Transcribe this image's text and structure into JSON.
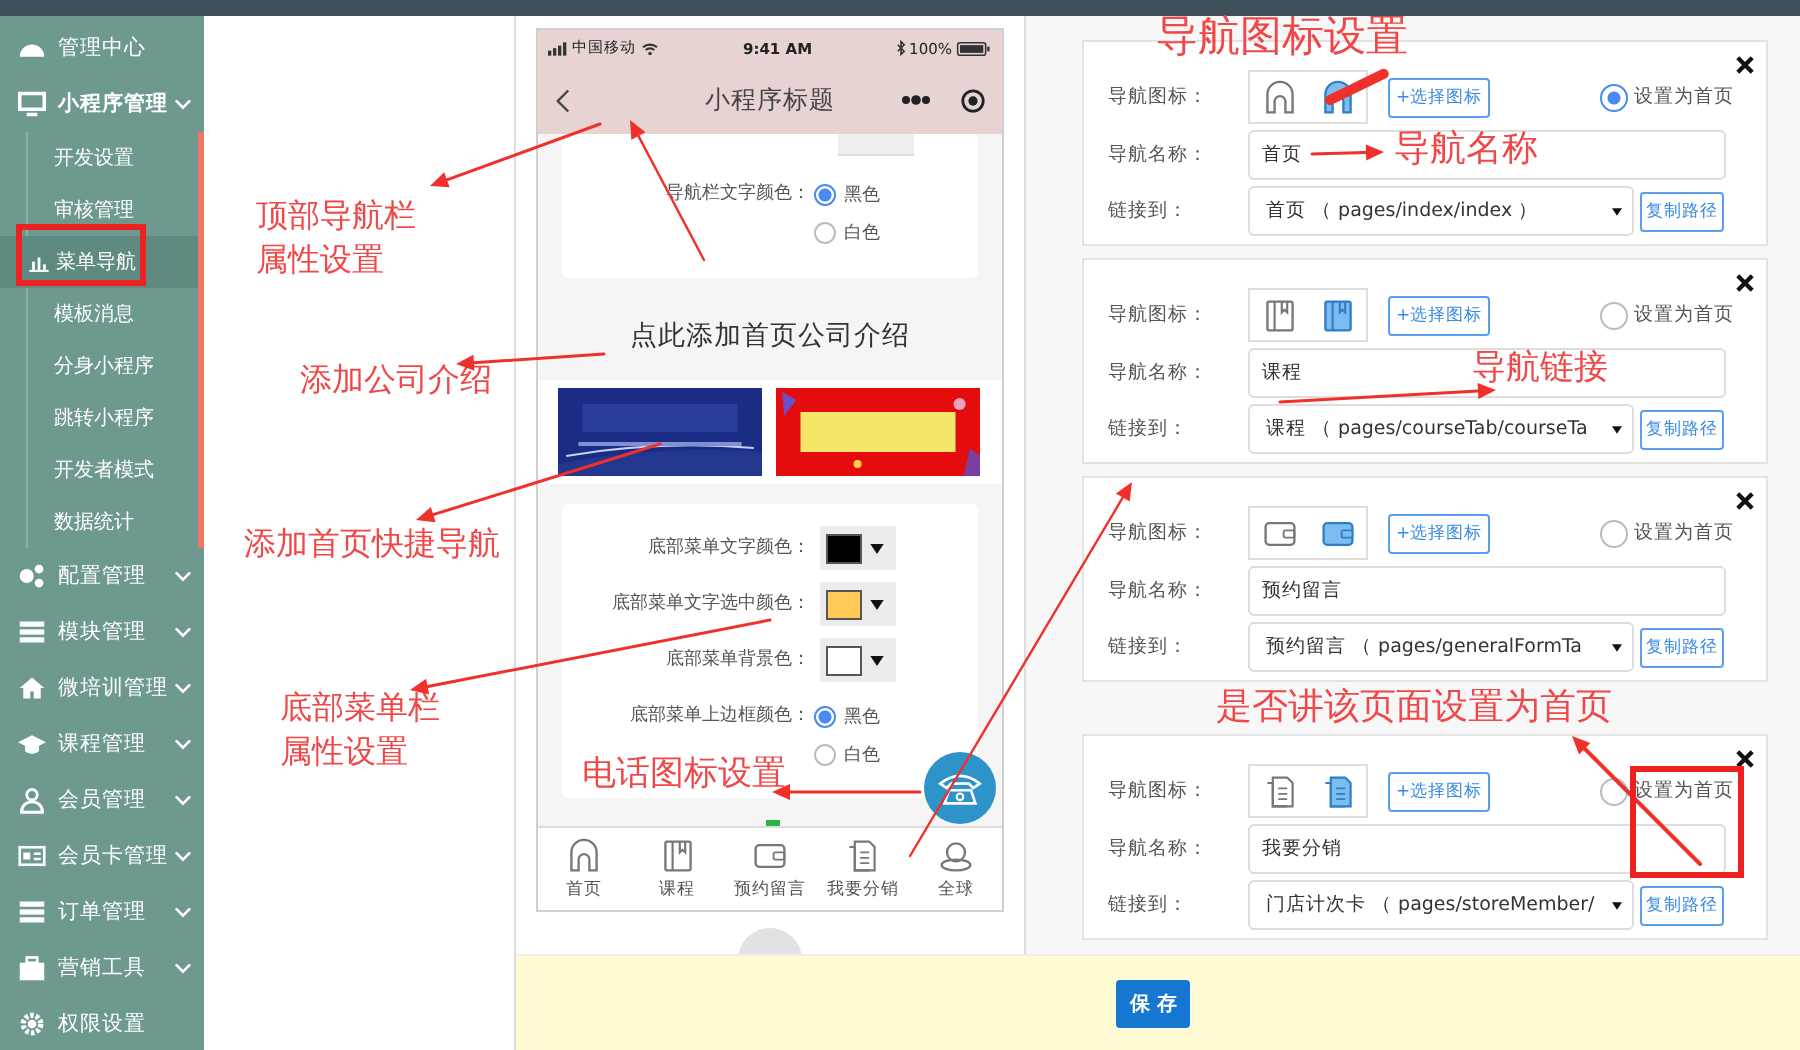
{
  "sidebar": {
    "items": [
      {
        "label": "管理中心",
        "kind": "link"
      },
      {
        "label": "小程序管理",
        "kind": "group",
        "expanded": true,
        "children": [
          {
            "label": "开发设置",
            "selected": false
          },
          {
            "label": "审核管理",
            "selected": false
          },
          {
            "label": "菜单导航",
            "selected": true
          },
          {
            "label": "模板消息",
            "selected": false
          },
          {
            "label": "分身小程序",
            "selected": false
          },
          {
            "label": "跳转小程序",
            "selected": false
          },
          {
            "label": "开发者模式",
            "selected": false
          },
          {
            "label": "数据统计",
            "selected": false
          }
        ]
      },
      {
        "label": "配置管理",
        "kind": "group",
        "expanded": false
      },
      {
        "label": "模块管理",
        "kind": "group",
        "expanded": false
      },
      {
        "label": "微培训管理",
        "kind": "group",
        "expanded": false
      },
      {
        "label": "课程管理",
        "kind": "group",
        "expanded": false
      },
      {
        "label": "会员管理",
        "kind": "group",
        "expanded": false
      },
      {
        "label": "会员卡管理",
        "kind": "group",
        "expanded": false
      },
      {
        "label": "订单管理",
        "kind": "group",
        "expanded": false
      },
      {
        "label": "营销工具",
        "kind": "group",
        "expanded": false
      },
      {
        "label": "权限设置",
        "kind": "link"
      }
    ]
  },
  "callouts": {
    "side": [
      "顶部导航栏属性设置",
      "添加公司介绍",
      "添加首页快捷导航",
      "底部菜单栏属性设置"
    ],
    "overlay": [
      "导航图标设置",
      "导航名称",
      "导航链接",
      "是否讲该页面设置为首页",
      "电话图标设置"
    ]
  },
  "phone": {
    "status": {
      "carrier": "中国移动",
      "time": "9:41 AM",
      "battery": "100%"
    },
    "title": "小程序标题",
    "nav_text_color": {
      "label": "导航栏文字颜色：",
      "options": [
        {
          "label": "黑色",
          "selected": true
        },
        {
          "label": "白色",
          "selected": false
        }
      ]
    },
    "intro": "点此添加首页公司介绍",
    "menu_colors": [
      {
        "label": "底部菜单文字颜色：",
        "color": "#000000"
      },
      {
        "label": "底部菜单文字选中颜色：",
        "color": "#ffc857"
      },
      {
        "label": "底部菜单背景色：",
        "color": "#ffffff"
      }
    ],
    "menu_border": {
      "label": "底部菜单上边框颜色：",
      "options": [
        {
          "label": "黑色",
          "selected": true
        },
        {
          "label": "白色",
          "selected": false
        }
      ]
    },
    "tabs": [
      {
        "label": "首页"
      },
      {
        "label": "课程"
      },
      {
        "label": "预约留言"
      },
      {
        "label": "我要分销"
      },
      {
        "label": "全球"
      }
    ]
  },
  "nav_items": [
    {
      "icon_label": "导航图标：",
      "select_icon": "+选择图标",
      "home_label": "设置为首页",
      "home": true,
      "name_label": "导航名称：",
      "name": "首页",
      "link_label": "链接到：",
      "link": "首页 （ pages/index/index ）",
      "copy": "复制路径"
    },
    {
      "icon_label": "导航图标：",
      "select_icon": "+选择图标",
      "home_label": "设置为首页",
      "home": false,
      "name_label": "导航名称：",
      "name": "课程",
      "link_label": "链接到：",
      "link": "课程 （ pages/courseTab/courseTa",
      "copy": "复制路径"
    },
    {
      "icon_label": "导航图标：",
      "select_icon": "+选择图标",
      "home_label": "设置为首页",
      "home": false,
      "name_label": "导航名称：",
      "name": "预约留言",
      "link_label": "链接到：",
      "link": "预约留言 （ pages/generalFormTa",
      "copy": "复制路径"
    },
    {
      "icon_label": "导航图标：",
      "select_icon": "+选择图标",
      "home_label": "设置为首页",
      "home": false,
      "name_label": "导航名称：",
      "name": "我要分销",
      "link_label": "链接到：",
      "link": "门店计次卡 （ pages/storeMember/",
      "copy": "复制路径"
    }
  ],
  "save_button": "保 存"
}
